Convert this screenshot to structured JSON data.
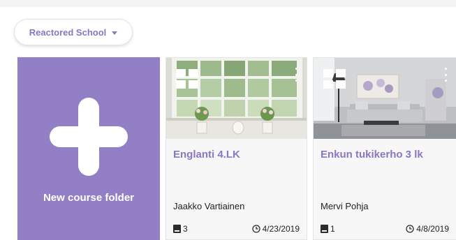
{
  "school_selector": {
    "label": "Reactored School",
    "icon": "chevron-down-icon"
  },
  "new_folder": {
    "label": "New course folder",
    "icon": "plus-icon"
  },
  "colors": {
    "accent": "#937fc6",
    "accent_text": "#8a76c2",
    "card_bg": "#f7f7f7"
  },
  "courses": [
    {
      "title": "Englanti 4.LK",
      "author": "Jaakko Vartiainen",
      "count": "3",
      "date": "4/23/2019",
      "thumbnail": "window-with-flower-pots"
    },
    {
      "title": "Enkun tukikerho 3 lk",
      "author": "Mervi Pohja",
      "count": "1",
      "date": "4/8/2019",
      "thumbnail": "living-room"
    }
  ]
}
